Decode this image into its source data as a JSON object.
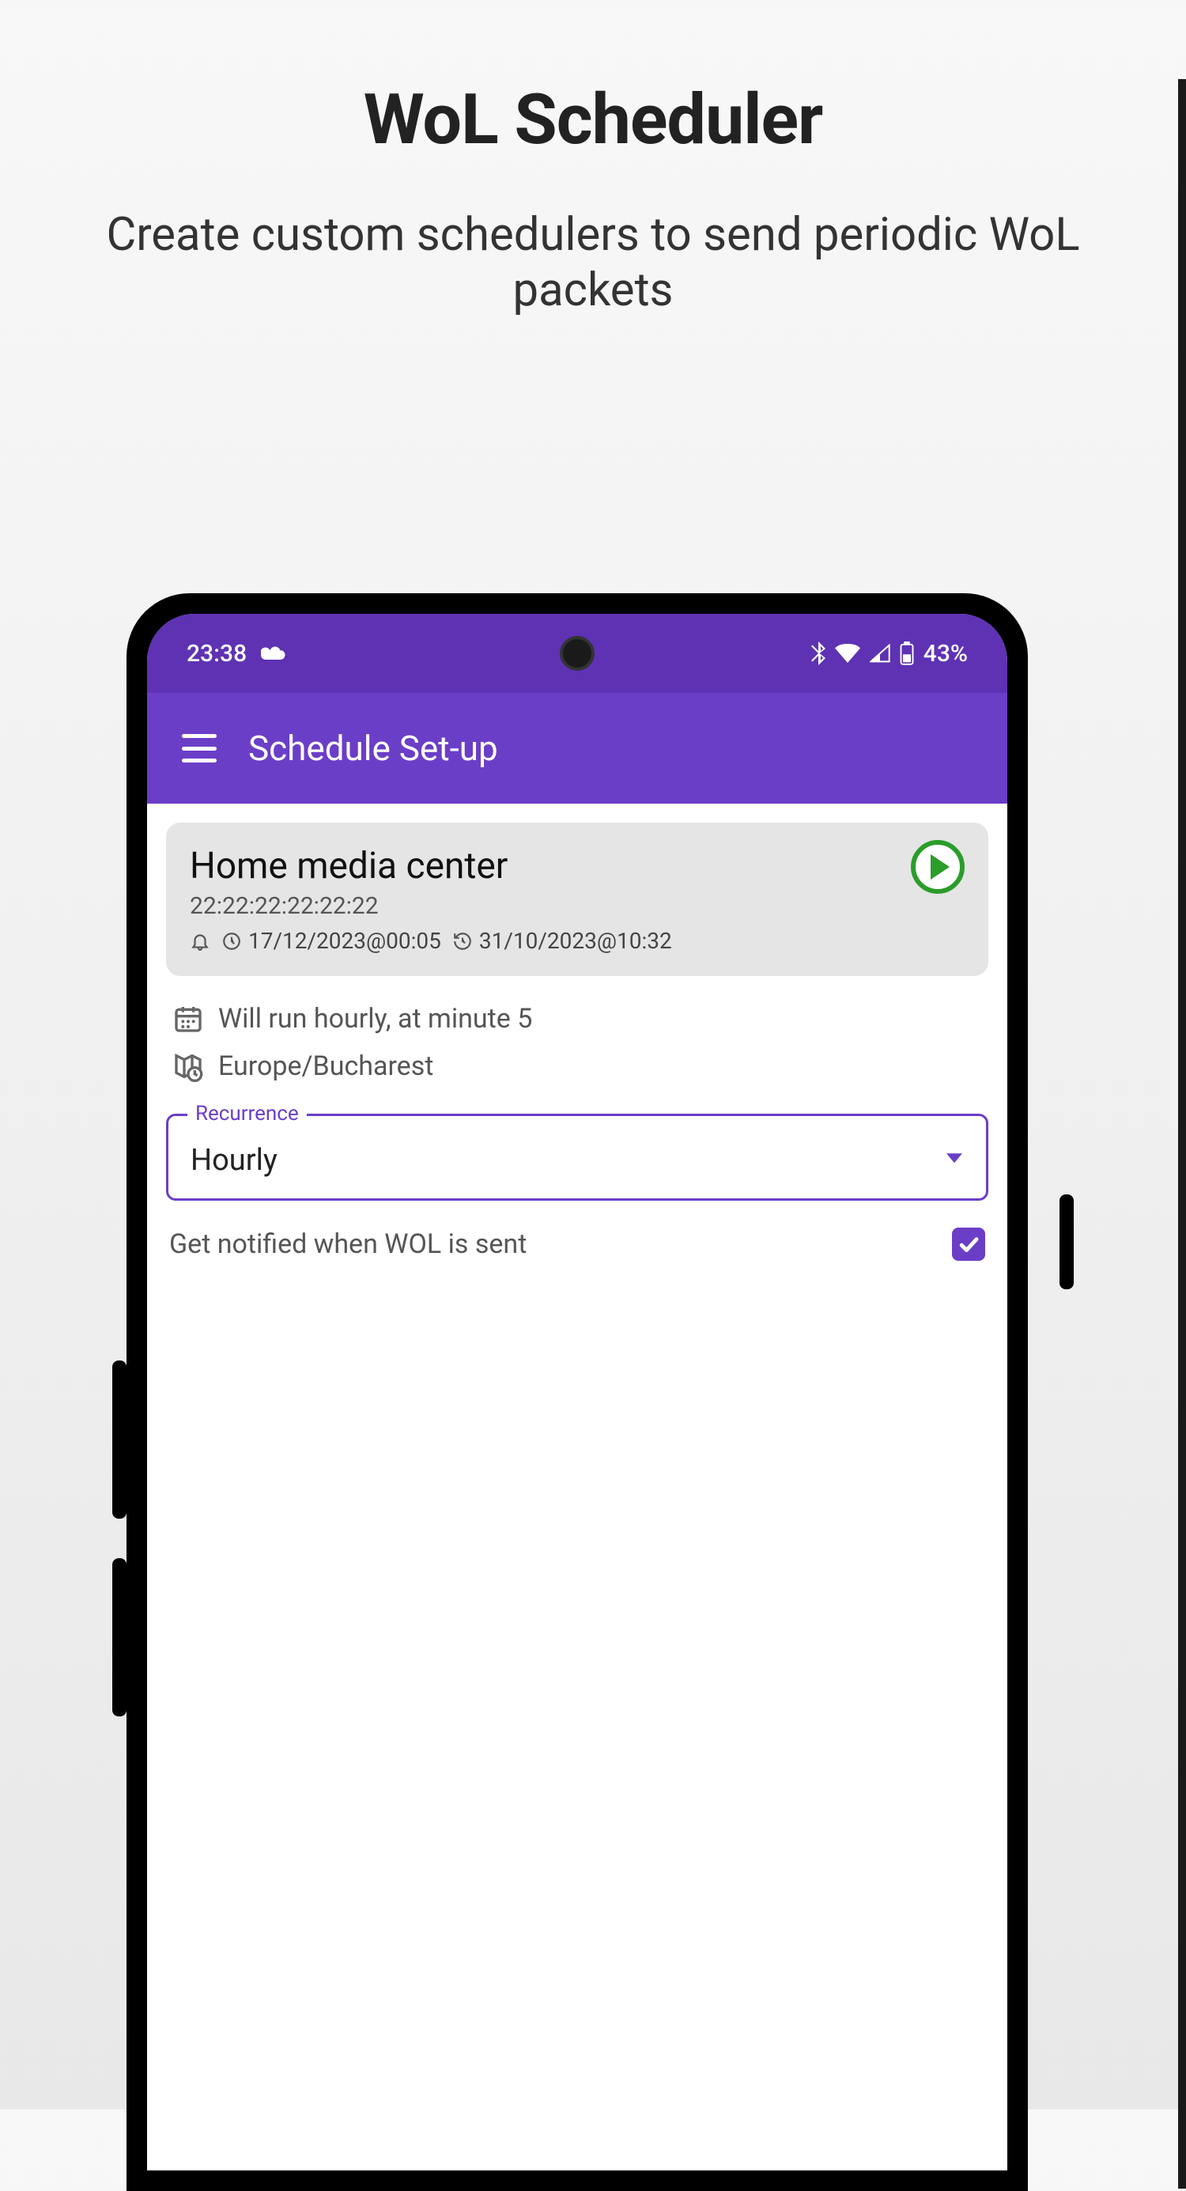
{
  "promo": {
    "title": "WoL Scheduler",
    "subtitle": "Create custom schedulers to send periodic WoL packets"
  },
  "status_bar": {
    "time": "23:38",
    "battery_text": "43%"
  },
  "app_bar": {
    "title": "Schedule Set-up"
  },
  "device": {
    "name": "Home media center",
    "mac": "22:22:22:22:22:22",
    "next_run": "17/12/2023@00:05",
    "last_run": "31/10/2023@10:32"
  },
  "schedule": {
    "summary": "Will run hourly, at minute 5",
    "timezone": "Europe/Bucharest",
    "recurrence_label": "Recurrence",
    "recurrence_value": "Hourly"
  },
  "notify": {
    "label": "Get notified when WOL is sent",
    "checked": true
  }
}
